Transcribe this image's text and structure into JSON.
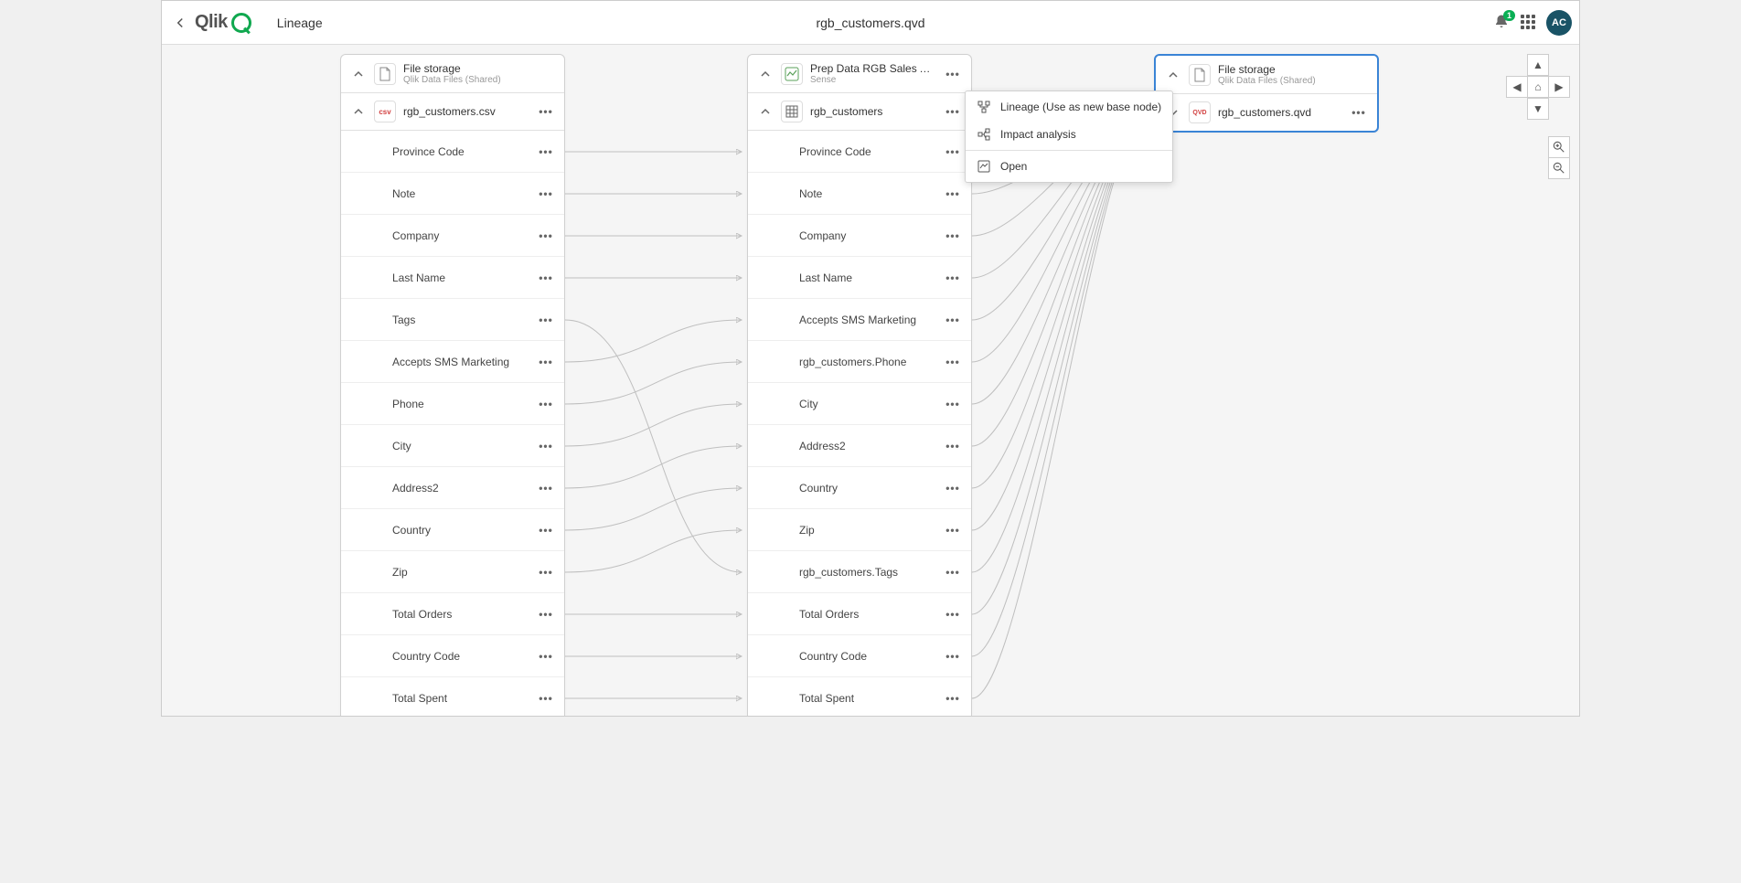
{
  "header": {
    "page": "Lineage",
    "file": "rgb_customers.qvd",
    "notifications": "1",
    "avatar": "AC"
  },
  "cards": {
    "source": {
      "title": "File storage",
      "subtitle": "Qlik Data Files (Shared)",
      "table": "rgb_customers.csv",
      "fields": [
        "Province Code",
        "Note",
        "Company",
        "Last Name",
        "Tags",
        "Accepts SMS Marketing",
        "Phone",
        "City",
        "Address2",
        "Country",
        "Zip",
        "Total Orders",
        "Country Code",
        "Total Spent"
      ]
    },
    "app": {
      "title": "Prep Data RGB Sales A…",
      "subtitle": "Sense",
      "table": "rgb_customers",
      "fields": [
        "Province Code",
        "Note",
        "Company",
        "Last Name",
        "Accepts SMS Marketing",
        "rgb_customers.Phone",
        "City",
        "Address2",
        "Country",
        "Zip",
        "rgb_customers.Tags",
        "Total Orders",
        "Country Code",
        "Total Spent"
      ]
    },
    "target": {
      "title": "File storage",
      "subtitle": "Qlik Data Files (Shared)",
      "table": "rgb_customers.qvd"
    }
  },
  "menu": {
    "lineage": "Lineage (Use as new base node)",
    "impact": "Impact analysis",
    "open": "Open"
  }
}
